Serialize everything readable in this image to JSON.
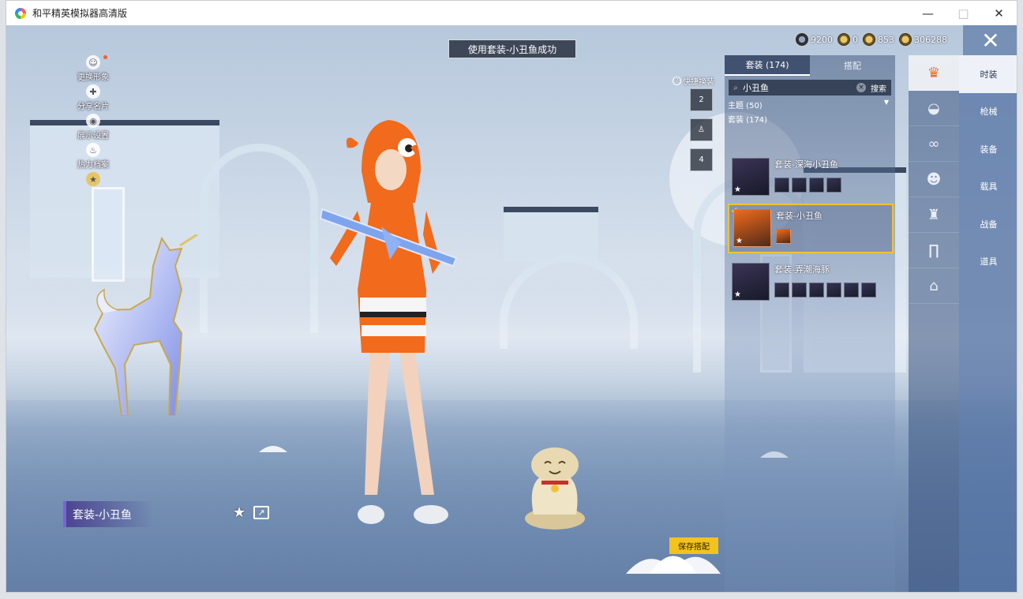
{
  "window": {
    "title": "和平精英模拟器高清版",
    "minimize": "—",
    "maximize": "□",
    "close": "✕"
  },
  "toast": "使用套装-小丑鱼成功",
  "left_menu": [
    {
      "icon": "person-icon",
      "glyph": "☺",
      "label": "更换形象",
      "dot": true
    },
    {
      "icon": "share-icon",
      "glyph": "✚",
      "label": "分享名片"
    },
    {
      "icon": "eye-icon",
      "glyph": "◉",
      "label": "展示设置"
    },
    {
      "icon": "fire-icon",
      "glyph": "♨",
      "label": "热力档案"
    },
    {
      "icon": "medal-icon",
      "glyph": "★",
      "label": ""
    }
  ],
  "currency": [
    {
      "icon": "gem-icon",
      "value": "9200",
      "dark": true
    },
    {
      "icon": "coin-icon",
      "value": "0",
      "dark": false
    },
    {
      "icon": "token-icon",
      "value": "853",
      "dark": false
    },
    {
      "icon": "gold-icon",
      "value": "306288",
      "dark": false
    }
  ],
  "quick_change": {
    "label": "快捷换装",
    "help": "?",
    "slots": [
      "2",
      "",
      "4"
    ]
  },
  "panel": {
    "tabs": [
      "套装 (174)",
      "搭配"
    ],
    "search": {
      "query": "小丑鱼",
      "clear": "×",
      "button": "搜索",
      "icon": "⌕"
    },
    "filter": {
      "theme": "主题 (50)",
      "arrow": "▼",
      "count": "套装 (174)"
    },
    "items": [
      {
        "name": "套装-深海小丑鱼",
        "parts": 4,
        "selected": false,
        "equipped": false
      },
      {
        "name": "套装-小丑鱼",
        "parts": 1,
        "selected": true,
        "equipped": true
      },
      {
        "name": "套装-弄潮海豚",
        "parts": 6,
        "selected": false,
        "equipped": false
      }
    ]
  },
  "categories": [
    {
      "label": "时装",
      "icon": "outfit-icon",
      "glyph": "♛",
      "active": true
    },
    {
      "label": "枪械",
      "icon": "hat-icon",
      "glyph": "◒"
    },
    {
      "label": "装备",
      "icon": "glasses-icon",
      "glyph": "∞"
    },
    {
      "label": "载具",
      "icon": "mask-icon",
      "glyph": "☻"
    },
    {
      "label": "战备",
      "icon": "top-icon",
      "glyph": "♜"
    },
    {
      "label": "道具",
      "icon": "pants-icon",
      "glyph": "∏"
    },
    {
      "label": "",
      "icon": "shoes-icon",
      "glyph": "⌂"
    }
  ],
  "outfit_name": "套装-小丑鱼",
  "actions": {
    "favorite": "★",
    "share": "↗",
    "save": "保存搭配",
    "exit": "✕"
  },
  "colors": {
    "accent": "#f3c21c",
    "selected_border": "#f2c233",
    "outfit_orange": "#f26a1b",
    "panel_blue": "#52709f"
  }
}
